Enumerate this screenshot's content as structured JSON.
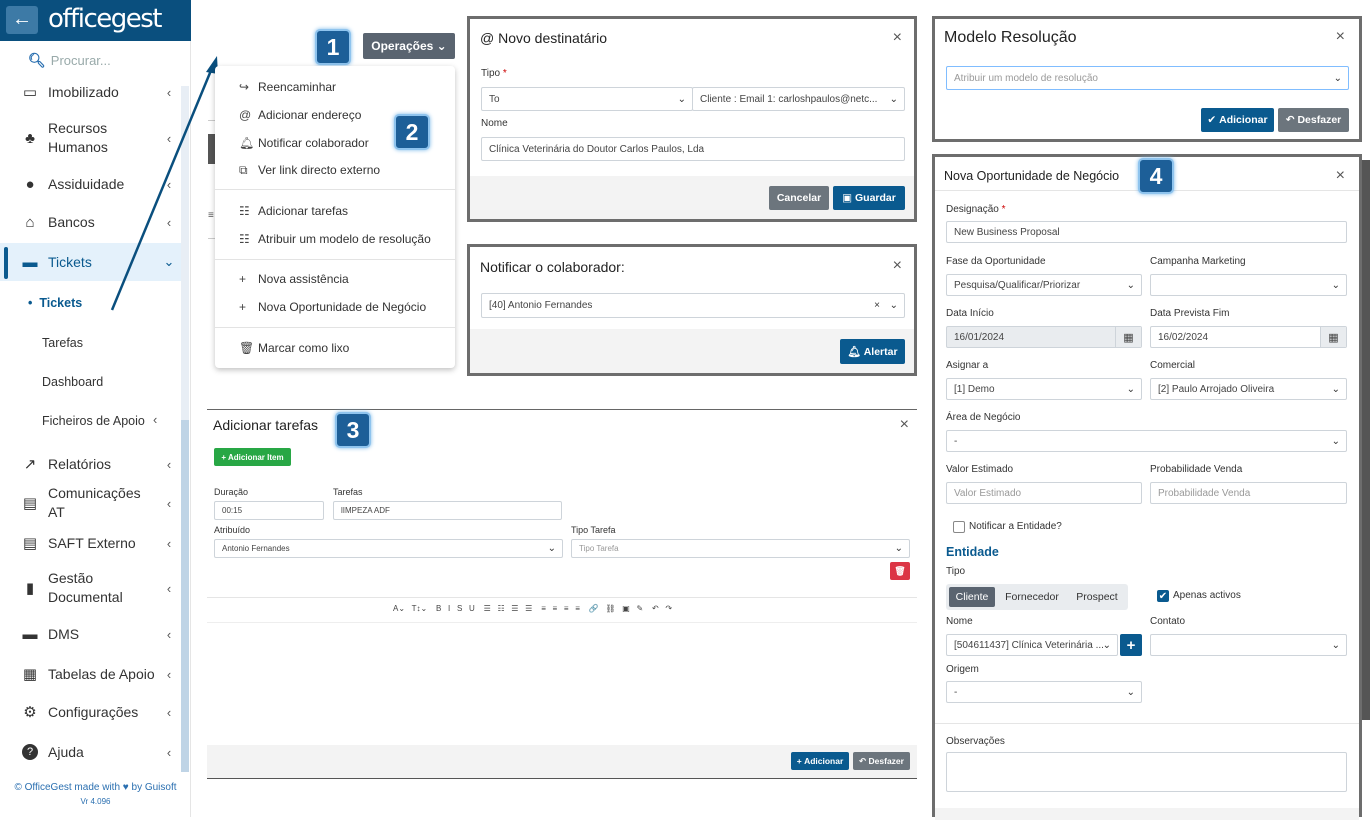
{
  "sidebar": {
    "brand": "officegest",
    "search_placeholder": "Procurar...",
    "items": [
      {
        "label": "Imobilizado",
        "icon": "▭"
      },
      {
        "label": "Recursos Humanos",
        "icon": "♣"
      },
      {
        "label": "Assiduidade",
        "icon": "●"
      },
      {
        "label": "Bancos",
        "icon": "⌂"
      },
      {
        "label": "Tickets",
        "icon": "▬"
      },
      {
        "label": "Relatórios",
        "icon": "↗"
      },
      {
        "label": "Comunicações AT",
        "icon": "▤"
      },
      {
        "label": "SAFT Externo",
        "icon": "▤"
      },
      {
        "label": "Gestão Documental",
        "icon": "▮"
      },
      {
        "label": "DMS",
        "icon": "▬"
      },
      {
        "label": "Tabelas de Apoio",
        "icon": "▦"
      },
      {
        "label": "Configurações",
        "icon": "⚙"
      },
      {
        "label": "Ajuda",
        "icon": "?"
      }
    ],
    "subitems": [
      "Tickets",
      "Tarefas",
      "Dashboard",
      "Ficheiros de Apoio"
    ],
    "footer": "© OfficeGest made with ♥ by Guisoft",
    "version": "Vr 4.096"
  },
  "badges": {
    "b1": "1",
    "b2": "2",
    "b3": "3",
    "b4": "4"
  },
  "operations": {
    "button_label": "Operações",
    "menu": [
      "Reencaminhar",
      "Adicionar endereço",
      "Notificar colaborador",
      "Ver link directo externo",
      "Adicionar tarefas",
      "Atribuir um modelo de resolução",
      "Nova assistência",
      "Nova Oportunidade de Negócio",
      "Marcar como lixo"
    ]
  },
  "novo_destinatario": {
    "title": "Novo destinatário",
    "tipo_label": "Tipo",
    "tipo_value": "To",
    "cliente_value": "Cliente : Email 1: carloshpaulos@netc...",
    "nome_label": "Nome",
    "nome_value": "Clínica Veterinária do Doutor Carlos Paulos, Lda",
    "cancel": "Cancelar",
    "save": "Guardar"
  },
  "notificar": {
    "title": "Notificar o colaborador:",
    "value": "[40] Antonio Fernandes",
    "alert": "Alertar"
  },
  "modelo": {
    "title": "Modelo Resolução",
    "placeholder": "Atribuir um modelo de resolução",
    "add": "Adicionar",
    "undo": "Desfazer"
  },
  "tarefas": {
    "title": "Adicionar tarefas",
    "add_item": "+ Adicionar Item",
    "duracao_label": "Duração",
    "duracao_value": "00:15",
    "tarefas_label": "Tarefas",
    "tarefas_value": "lIMPEZA ADF",
    "atribuido_label": "Atribuído",
    "atribuido_value": "Antonio Fernandes",
    "tipo_label": "Tipo Tarefa",
    "tipo_placeholder": "Tipo Tarefa",
    "toolbar": "A⌄   T↕⌄    B   I   S   U    ☰   ☷   ☰   ☰    ≡   ≡   ≡   ≡    🔗   ⛓   ▣   ✎    ↶   ↷",
    "add": "Adicionar",
    "undo": "Desfazer"
  },
  "oportunidade": {
    "title": "Nova Oportunidade de Negócio",
    "designacao_label": "Designação",
    "designacao_value": "New Business Proposal",
    "fase_label": "Fase da Oportunidade",
    "fase_value": "Pesquisa/Qualificar/Priorizar",
    "campanha_label": "Campanha Marketing",
    "data_inicio_label": "Data Início",
    "data_inicio_value": "16/01/2024",
    "data_fim_label": "Data Prevista Fim",
    "data_fim_value": "16/02/2024",
    "asignar_label": "Asignar a",
    "asignar_value": "[1] Demo",
    "comercial_label": "Comercial",
    "comercial_value": "[2] Paulo Arrojado Oliveira",
    "area_label": "Área de Negócio",
    "area_value": "-",
    "valor_label": "Valor Estimado",
    "valor_placeholder": "Valor Estimado",
    "prob_label": "Probabilidade Venda",
    "prob_placeholder": "Probabilidade Venda",
    "notificar_label": "Notificar a Entidade?",
    "entidade_heading": "Entidade",
    "tipo_label": "Tipo",
    "tipo_options": [
      "Cliente",
      "Fornecedor",
      "Prospect"
    ],
    "apenas_label": "Apenas activos",
    "nome_label": "Nome",
    "nome_value": "[504611437] Clínica Veterinária ...",
    "contato_label": "Contato",
    "origem_label": "Origem",
    "origem_value": "-",
    "obs_label": "Observações"
  }
}
